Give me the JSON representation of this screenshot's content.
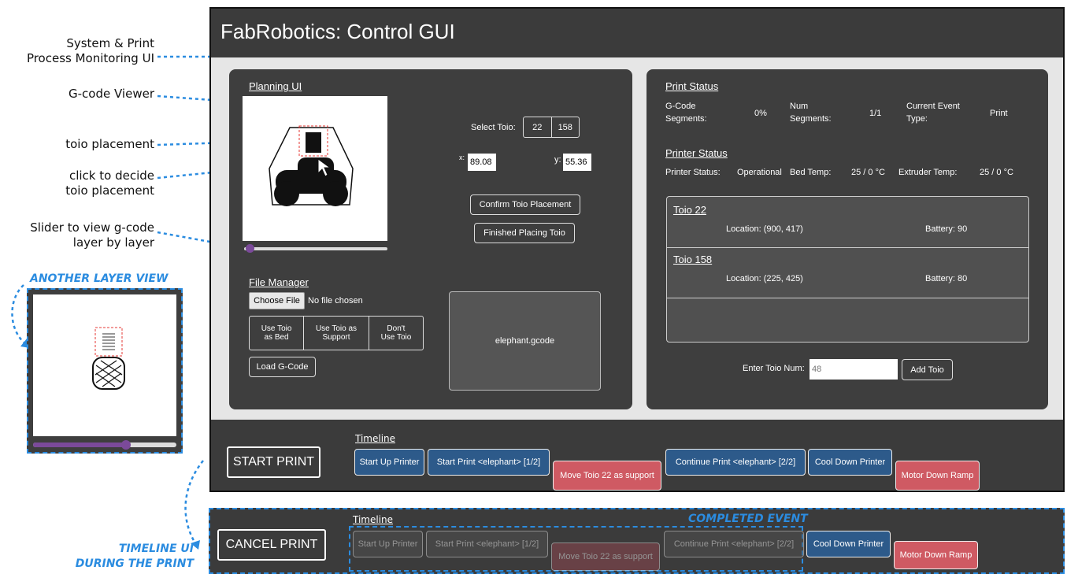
{
  "annotations": {
    "monitoring_l1": "System & Print",
    "monitoring_l2": "Process Monitoring UI",
    "gcode_viewer": "G-code Viewer",
    "toio_placement": "toio placement",
    "click_l1": "click to decide",
    "click_l2": "toio placement",
    "slider_l1": "Slider to view g-code",
    "slider_l2": "layer by layer",
    "another_layer": "ANOTHER LAYER VIEW",
    "timeline_ui_l1": "TIMELINE UI",
    "timeline_ui_l2": "DURING THE PRINT",
    "completed_event": "COMPLETED EVENT"
  },
  "app": {
    "title": "FabRobotics: Control GUI"
  },
  "planning": {
    "label": "Planning UI",
    "select_toio_label": "Select Toio:",
    "toio_options": [
      "22",
      "158"
    ],
    "x_label": "x:",
    "x_value": "89.08",
    "y_label": "y:",
    "y_value": "55.36",
    "confirm_button": "Confirm Toio Placement",
    "finished_button": "Finished Placing Toio",
    "slider_level": 0.02
  },
  "file_manager": {
    "label": "File Manager",
    "choose_file": "Choose File",
    "no_file": "No file chosen",
    "options": [
      {
        "l1": "Use Toio",
        "l2": "as Bed"
      },
      {
        "l1": "Use Toio as",
        "l2": "Support"
      },
      {
        "l1": "Don't",
        "l2": "Use Toio"
      }
    ],
    "load_button": "Load G-Code",
    "file_name": "elephant.gcode"
  },
  "print_status": {
    "label": "Print Status",
    "gcode_l1": "G-Code",
    "gcode_l2": "Segments:",
    "gcode_value": "0%",
    "num_l1": "Num",
    "num_l2": "Segments:",
    "num_value": "1/1",
    "event_l1": "Current Event",
    "event_l2": "Type:",
    "event_value": "Print"
  },
  "printer_status": {
    "label": "Printer Status",
    "status_label": "Printer Status:",
    "status_value": "Operational",
    "bed_label": "Bed Temp:",
    "bed_value": "25 / 0 °C",
    "extruder_label": "Extruder Temp:",
    "extruder_value": "25 / 0 °C"
  },
  "toios": [
    {
      "name": "Toio 22",
      "location": "Location: (900, 417)",
      "battery": "Battery: 90"
    },
    {
      "name": "Toio 158",
      "location": "Location: (225, 425)",
      "battery": "Battery: 80"
    }
  ],
  "add_toio": {
    "label": "Enter Toio Num:",
    "value": "48",
    "button": "Add Toio"
  },
  "timeline": {
    "label": "Timeline",
    "start_print": "START PRINT",
    "cancel_print": "CANCEL PRINT",
    "events": [
      "Start Up Printer",
      "Start Print <elephant> [1/2]",
      "Move Toio 22 as support",
      "Continue Print <elephant> [2/2]",
      "Cool Down Printer",
      "Motor Down Ramp"
    ]
  },
  "colors": {
    "accent_blue": "#2b8ce0",
    "event_blue": "#2d5a8a",
    "event_red": "#cf5a63",
    "slider_purple": "#7b4a9a"
  },
  "another_layer_slider_level": 0.65
}
